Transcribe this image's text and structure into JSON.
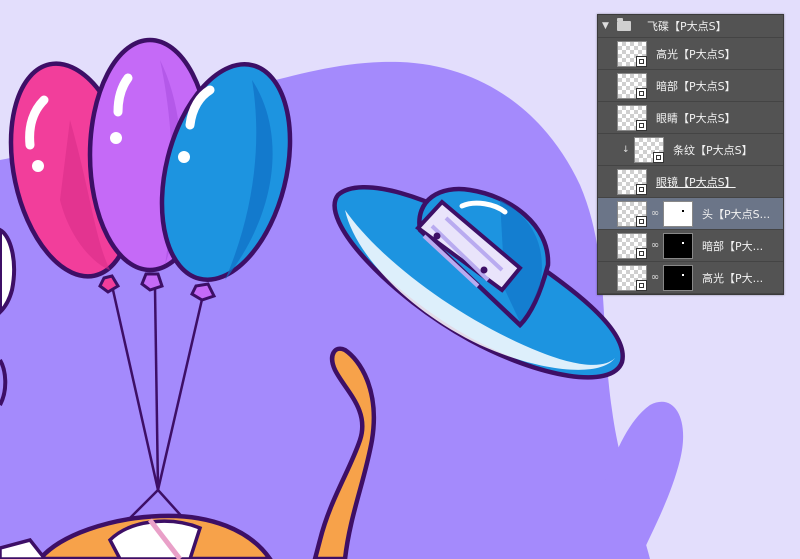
{
  "colors": {
    "background": "#e3defc",
    "blob": "#a48afc",
    "outline": "#3d0f66",
    "balloon_pink": "#f23e9b",
    "balloon_purple": "#c56af7",
    "balloon_blue": "#1d94e0",
    "ufo_blue": "#1d94e0",
    "cat_orange": "#f7a24a",
    "panel_bg": "#535353",
    "panel_selected": "#6b7588"
  },
  "illustration": {
    "elements": [
      "balloon-pink",
      "balloon-purple",
      "balloon-blue",
      "ufo",
      "cat-tail",
      "cat-head"
    ]
  },
  "layers_panel": {
    "group": {
      "name": "飞碟【P大点S】",
      "expanded": true,
      "icon": "folder-icon"
    },
    "layers": [
      {
        "name": "高光【P大点S】",
        "clipped": false,
        "mask": null,
        "selected": false,
        "underline": false
      },
      {
        "name": "暗部【P大点S】",
        "clipped": false,
        "mask": null,
        "selected": false,
        "underline": false
      },
      {
        "name": "眼睛【P大点S】",
        "clipped": false,
        "mask": null,
        "selected": false,
        "underline": false
      },
      {
        "name": "条纹【P大点S】",
        "clipped": true,
        "mask": null,
        "selected": false,
        "underline": false
      },
      {
        "name": "眼镜【P大点S】",
        "clipped": false,
        "mask": null,
        "selected": false,
        "underline": true
      },
      {
        "name": "头【P大点S...",
        "clipped": false,
        "mask": "white",
        "selected": true,
        "underline": false
      },
      {
        "name": "暗部【P大...",
        "clipped": false,
        "mask": "black",
        "selected": false,
        "underline": false
      },
      {
        "name": "高光【P大...",
        "clipped": false,
        "mask": "black",
        "selected": false,
        "underline": false
      }
    ]
  }
}
